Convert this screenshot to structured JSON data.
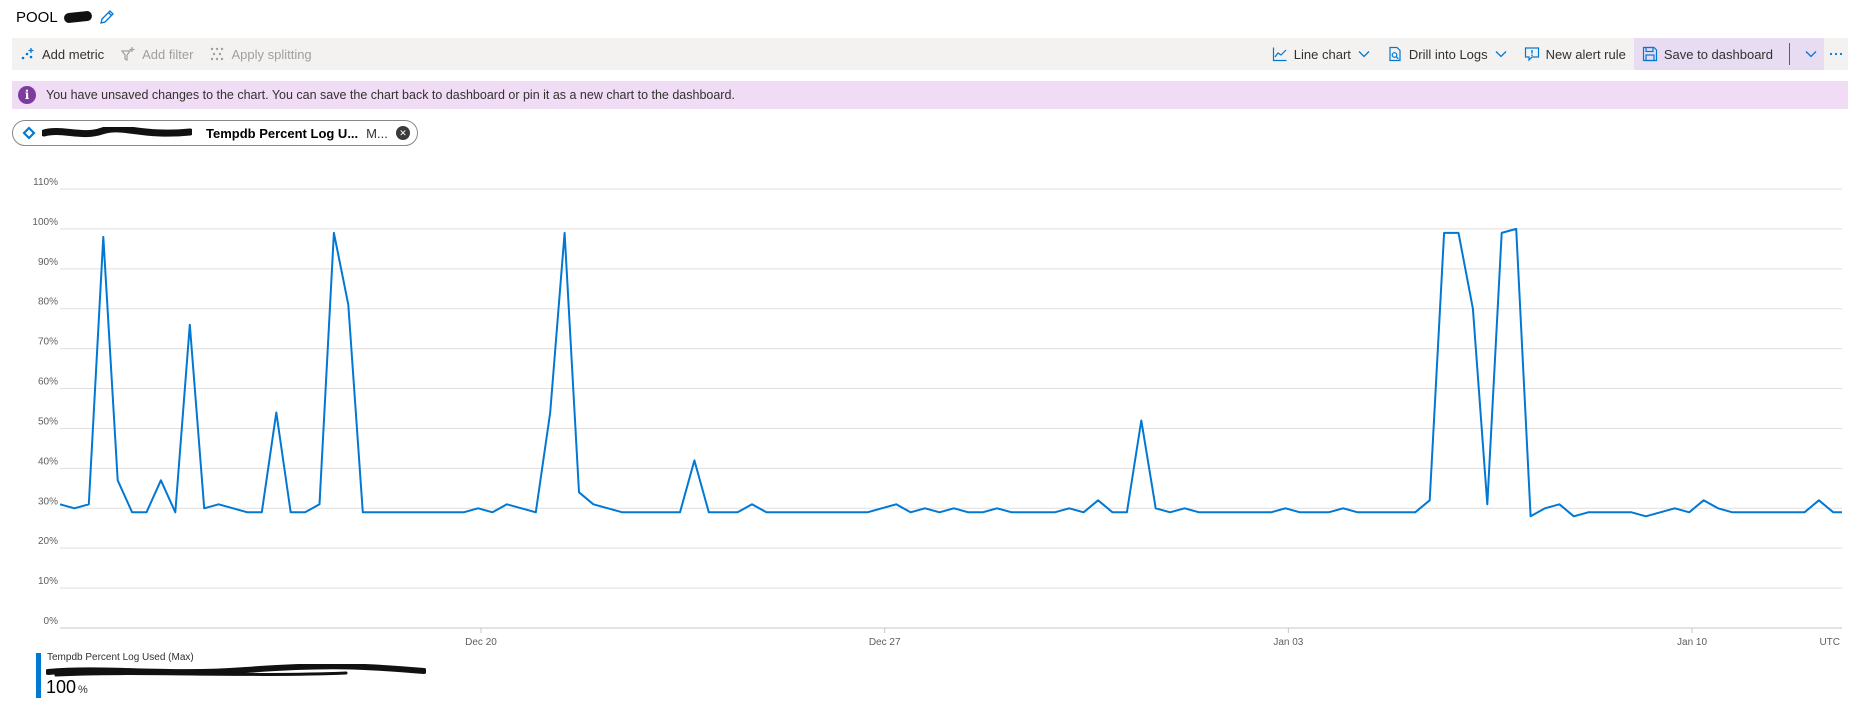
{
  "title": "POOL",
  "toolbar": {
    "left": [
      {
        "label": "Add metric",
        "icon": "add-metric-icon",
        "enabled": true
      },
      {
        "label": "Add filter",
        "icon": "add-filter-icon",
        "enabled": false
      },
      {
        "label": "Apply splitting",
        "icon": "apply-splitting-icon",
        "enabled": false
      }
    ],
    "right": [
      {
        "label": "Line chart",
        "icon": "line-chart-icon",
        "dropdown": true
      },
      {
        "label": "Drill into Logs",
        "icon": "drill-logs-icon",
        "dropdown": true
      },
      {
        "label": "New alert rule",
        "icon": "alert-rule-icon",
        "dropdown": false
      },
      {
        "label": "Save to dashboard",
        "icon": "save-icon",
        "dropdown": true
      }
    ],
    "more_icon": "ellipsis-icon"
  },
  "banner": {
    "text": "You have unsaved changes to the chart. You can save the chart back to dashboard or pin it as a new chart to the dashboard.",
    "icon": "info-icon"
  },
  "metric_pill": {
    "metric": "Tempdb Percent Log U...",
    "aggregation": "M...",
    "icon": "resource-diamond-icon"
  },
  "chart_data": {
    "type": "line",
    "y_ticks": [
      "0%",
      "10%",
      "20%",
      "30%",
      "40%",
      "50%",
      "60%",
      "70%",
      "80%",
      "90%",
      "100%",
      "110%"
    ],
    "ylim": [
      0,
      110
    ],
    "x_ticks": [
      {
        "label": "Dec 20",
        "day": 7
      },
      {
        "label": "Dec 27",
        "day": 14
      },
      {
        "label": "Jan 03",
        "day": 21
      },
      {
        "label": "Jan 10",
        "day": 28
      }
    ],
    "x_unit_label": "UTC",
    "xlim": [
      -0.3,
      30.6
    ],
    "grid": true,
    "series": [
      {
        "name": "Tempdb Percent Log Used (Max)",
        "color": "#0078d4",
        "points": [
          [
            -0.3,
            31
          ],
          [
            -0.05,
            30
          ],
          [
            0.2,
            31
          ],
          [
            0.45,
            98
          ],
          [
            0.7,
            37
          ],
          [
            0.95,
            29
          ],
          [
            1.2,
            29
          ],
          [
            1.45,
            37
          ],
          [
            1.7,
            29
          ],
          [
            1.95,
            76
          ],
          [
            2.2,
            30
          ],
          [
            2.45,
            31
          ],
          [
            2.7,
            30
          ],
          [
            2.95,
            29
          ],
          [
            3.2,
            29
          ],
          [
            3.45,
            54
          ],
          [
            3.7,
            29
          ],
          [
            3.95,
            29
          ],
          [
            4.2,
            31
          ],
          [
            4.45,
            99
          ],
          [
            4.7,
            81
          ],
          [
            4.95,
            29
          ],
          [
            5.2,
            29
          ],
          [
            5.45,
            29
          ],
          [
            5.7,
            29
          ],
          [
            5.95,
            29
          ],
          [
            6.2,
            29
          ],
          [
            6.45,
            29
          ],
          [
            6.7,
            29
          ],
          [
            6.95,
            30
          ],
          [
            7.2,
            29
          ],
          [
            7.45,
            31
          ],
          [
            7.7,
            30
          ],
          [
            7.95,
            29
          ],
          [
            8.2,
            54
          ],
          [
            8.45,
            99
          ],
          [
            8.7,
            34
          ],
          [
            8.95,
            31
          ],
          [
            9.2,
            30
          ],
          [
            9.45,
            29
          ],
          [
            9.7,
            29
          ],
          [
            9.95,
            29
          ],
          [
            10.2,
            29
          ],
          [
            10.45,
            29
          ],
          [
            10.7,
            42
          ],
          [
            10.95,
            29
          ],
          [
            11.2,
            29
          ],
          [
            11.45,
            29
          ],
          [
            11.7,
            31
          ],
          [
            11.95,
            29
          ],
          [
            12.2,
            29
          ],
          [
            12.45,
            29
          ],
          [
            12.7,
            29
          ],
          [
            12.95,
            29
          ],
          [
            13.2,
            29
          ],
          [
            13.45,
            29
          ],
          [
            13.7,
            29
          ],
          [
            13.95,
            30
          ],
          [
            14.2,
            31
          ],
          [
            14.45,
            29
          ],
          [
            14.7,
            30
          ],
          [
            14.95,
            29
          ],
          [
            15.2,
            30
          ],
          [
            15.45,
            29
          ],
          [
            15.7,
            29
          ],
          [
            15.95,
            30
          ],
          [
            16.2,
            29
          ],
          [
            16.45,
            29
          ],
          [
            16.7,
            29
          ],
          [
            16.95,
            29
          ],
          [
            17.2,
            30
          ],
          [
            17.45,
            29
          ],
          [
            17.7,
            32
          ],
          [
            17.95,
            29
          ],
          [
            18.2,
            29
          ],
          [
            18.45,
            52
          ],
          [
            18.7,
            30
          ],
          [
            18.95,
            29
          ],
          [
            19.2,
            30
          ],
          [
            19.45,
            29
          ],
          [
            19.7,
            29
          ],
          [
            19.95,
            29
          ],
          [
            20.2,
            29
          ],
          [
            20.45,
            29
          ],
          [
            20.7,
            29
          ],
          [
            20.95,
            30
          ],
          [
            21.2,
            29
          ],
          [
            21.45,
            29
          ],
          [
            21.7,
            29
          ],
          [
            21.95,
            30
          ],
          [
            22.2,
            29
          ],
          [
            22.45,
            29
          ],
          [
            22.7,
            29
          ],
          [
            22.95,
            29
          ],
          [
            23.2,
            29
          ],
          [
            23.45,
            32
          ],
          [
            23.7,
            99
          ],
          [
            23.95,
            99
          ],
          [
            24.2,
            80
          ],
          [
            24.45,
            31
          ],
          [
            24.7,
            99
          ],
          [
            24.95,
            100
          ],
          [
            25.2,
            28
          ],
          [
            25.45,
            30
          ],
          [
            25.7,
            31
          ],
          [
            25.95,
            28
          ],
          [
            26.2,
            29
          ],
          [
            26.45,
            29
          ],
          [
            26.7,
            29
          ],
          [
            26.95,
            29
          ],
          [
            27.2,
            28
          ],
          [
            27.45,
            29
          ],
          [
            27.7,
            30
          ],
          [
            27.95,
            29
          ],
          [
            28.2,
            32
          ],
          [
            28.45,
            30
          ],
          [
            28.7,
            29
          ],
          [
            28.95,
            29
          ],
          [
            29.2,
            29
          ],
          [
            29.45,
            29
          ],
          [
            29.7,
            29
          ],
          [
            29.95,
            29
          ],
          [
            30.2,
            32
          ],
          [
            30.45,
            29
          ],
          [
            30.6,
            29
          ]
        ]
      }
    ]
  },
  "legend": {
    "label": "Tempdb Percent Log Used (Max)",
    "value": "100",
    "unit": "%"
  }
}
